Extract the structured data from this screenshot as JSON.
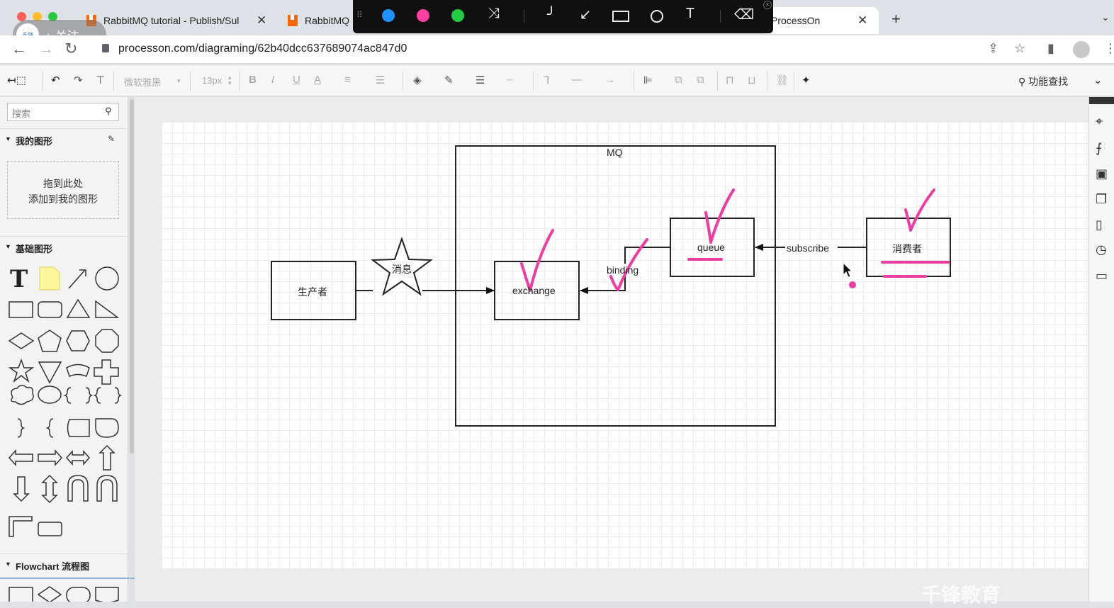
{
  "browser": {
    "tabs": [
      {
        "title": "RabbitMQ tutorial - Publish/Sul"
      },
      {
        "title": "RabbitMQ"
      },
      {
        "title": "ProcessOn"
      }
    ],
    "follow_label": "+ 关注",
    "url": "processon.com/diagraming/62b40dcc637689074ac847d0"
  },
  "annotation_toolbar": {
    "colors": [
      "#1e90ff",
      "#ff3fa4",
      "#22cc44"
    ]
  },
  "editor_toolbar": {
    "font_name": "微软雅黑",
    "font_size": "13px",
    "feature_search": "功能查找"
  },
  "sidebar": {
    "search_placeholder": "搜索",
    "my_shapes_title": "我的图形",
    "dropzone_line1": "拖到此处",
    "dropzone_line2": "添加到我的图形",
    "basic_shapes_title": "基础图形",
    "flowchart_title": "Flowchart 流程图"
  },
  "diagram": {
    "mq_label": "MQ",
    "producer": "生产者",
    "message": "消息",
    "exchange": "exchange",
    "binding": "binding",
    "queue": "queue",
    "subscribe": "subscribe",
    "consumer": "消费者"
  },
  "watermark": "千锋教育"
}
